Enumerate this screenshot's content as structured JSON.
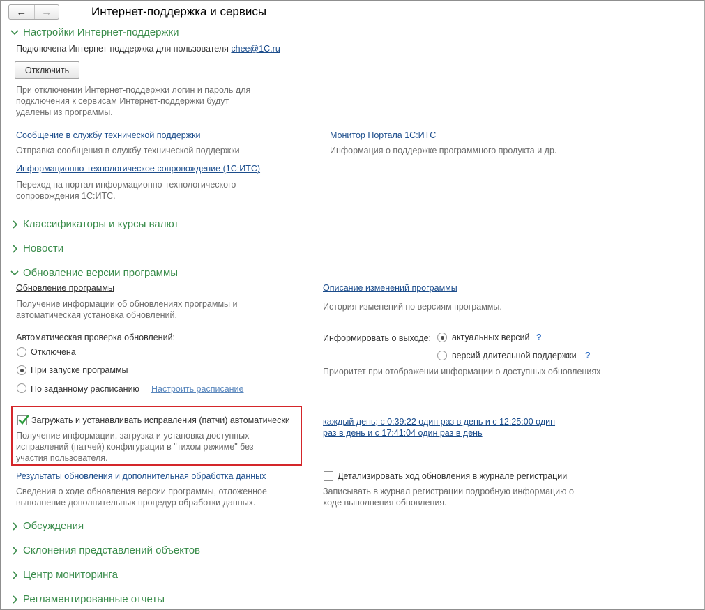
{
  "window": {
    "title": "Интернет-поддержка и сервисы"
  },
  "nav": {
    "back_icon": "←",
    "forward_icon": "→"
  },
  "support_settings": {
    "header": "Настройки Интернет-поддержки",
    "connected_text": "Подключена Интернет-поддержка для пользователя",
    "user_login": "chee@1C.ru",
    "disconnect_button": "Отключить",
    "disconnect_note_1": "При отключении Интернет-поддержки логин и пароль для",
    "disconnect_note_2": "подключения к сервисам Интернет-поддержки будут",
    "disconnect_note_3": "удалены из программы.",
    "message_link": "Сообщение в службу технической поддержки",
    "message_desc": "Отправка сообщения в службу технической поддержки",
    "monitor_link": "Монитор Портала 1С:ИТС",
    "monitor_desc": "Информация о поддержке программного продукта и др.",
    "its_link": "Информационно-технологическое сопровождение (1С:ИТС)",
    "its_desc_1": "Переход на портал информационно-технологического",
    "its_desc_2": "сопровождения 1С:ИТС."
  },
  "groups": {
    "classifiers": "Классификаторы и курсы валют",
    "news": "Новости",
    "update": "Обновление версии программы",
    "discussions": "Обсуждения",
    "declensions": "Склонения представлений объектов",
    "monitoring": "Центр мониторинга",
    "reports": "Регламентированные отчеты"
  },
  "update": {
    "program_update_link": "Обновление программы",
    "program_update_desc_1": "Получение информации об обновлениях программы и",
    "program_update_desc_2": "автоматическая установка обновлений.",
    "changes_link": "Описание изменений программы",
    "changes_desc": "История изменений по версиям программы.",
    "auto_check_label": "Автоматическая проверка обновлений:",
    "auto_check_options": [
      "Отключена",
      "При запуске программы",
      "По заданному расписанию"
    ],
    "auto_check_selected": "При запуске программы",
    "schedule_link": "Настроить расписание",
    "inform_label": "Информировать о выходе:",
    "inform_options": [
      "актуальных версий",
      "версий длительной поддержки"
    ],
    "inform_selected": "актуальных версий",
    "help_mark": "?",
    "priority_note": "Приоритет при отображении информации о доступных обновлениях",
    "patches_checkbox": "Загружать и устанавливать исправления (патчи) автоматически",
    "patches_checked": true,
    "patches_desc_1": "Получение информации, загрузка и установка доступных",
    "patches_desc_2": "исправлений (патчей) конфигурации в \"тихом режиме\" без",
    "patches_desc_3": "участия пользователя.",
    "patch_schedule_1": "каждый день; с 0:39:22 один раз в день и с 12:25:00 один",
    "patch_schedule_2": "раз в день и с 17:41:04 один раз в день",
    "results_link": "Результаты обновления и дополнительная обработка данных",
    "results_desc_1": "Сведения о ходе обновления версии программы, отложенное",
    "results_desc_2": "выполнение дополнительных процедур обработки данных.",
    "detail_checkbox": "Детализировать ход обновления в журнале регистрации",
    "detail_checked": false,
    "detail_desc_1": "Записывать в журнал регистрации подробную информацию о",
    "detail_desc_2": "ходе выполнения обновления."
  },
  "colors": {
    "group_header": "#3a8c4b",
    "link": "#1c4d8c",
    "highlight_border": "#d4262a"
  }
}
